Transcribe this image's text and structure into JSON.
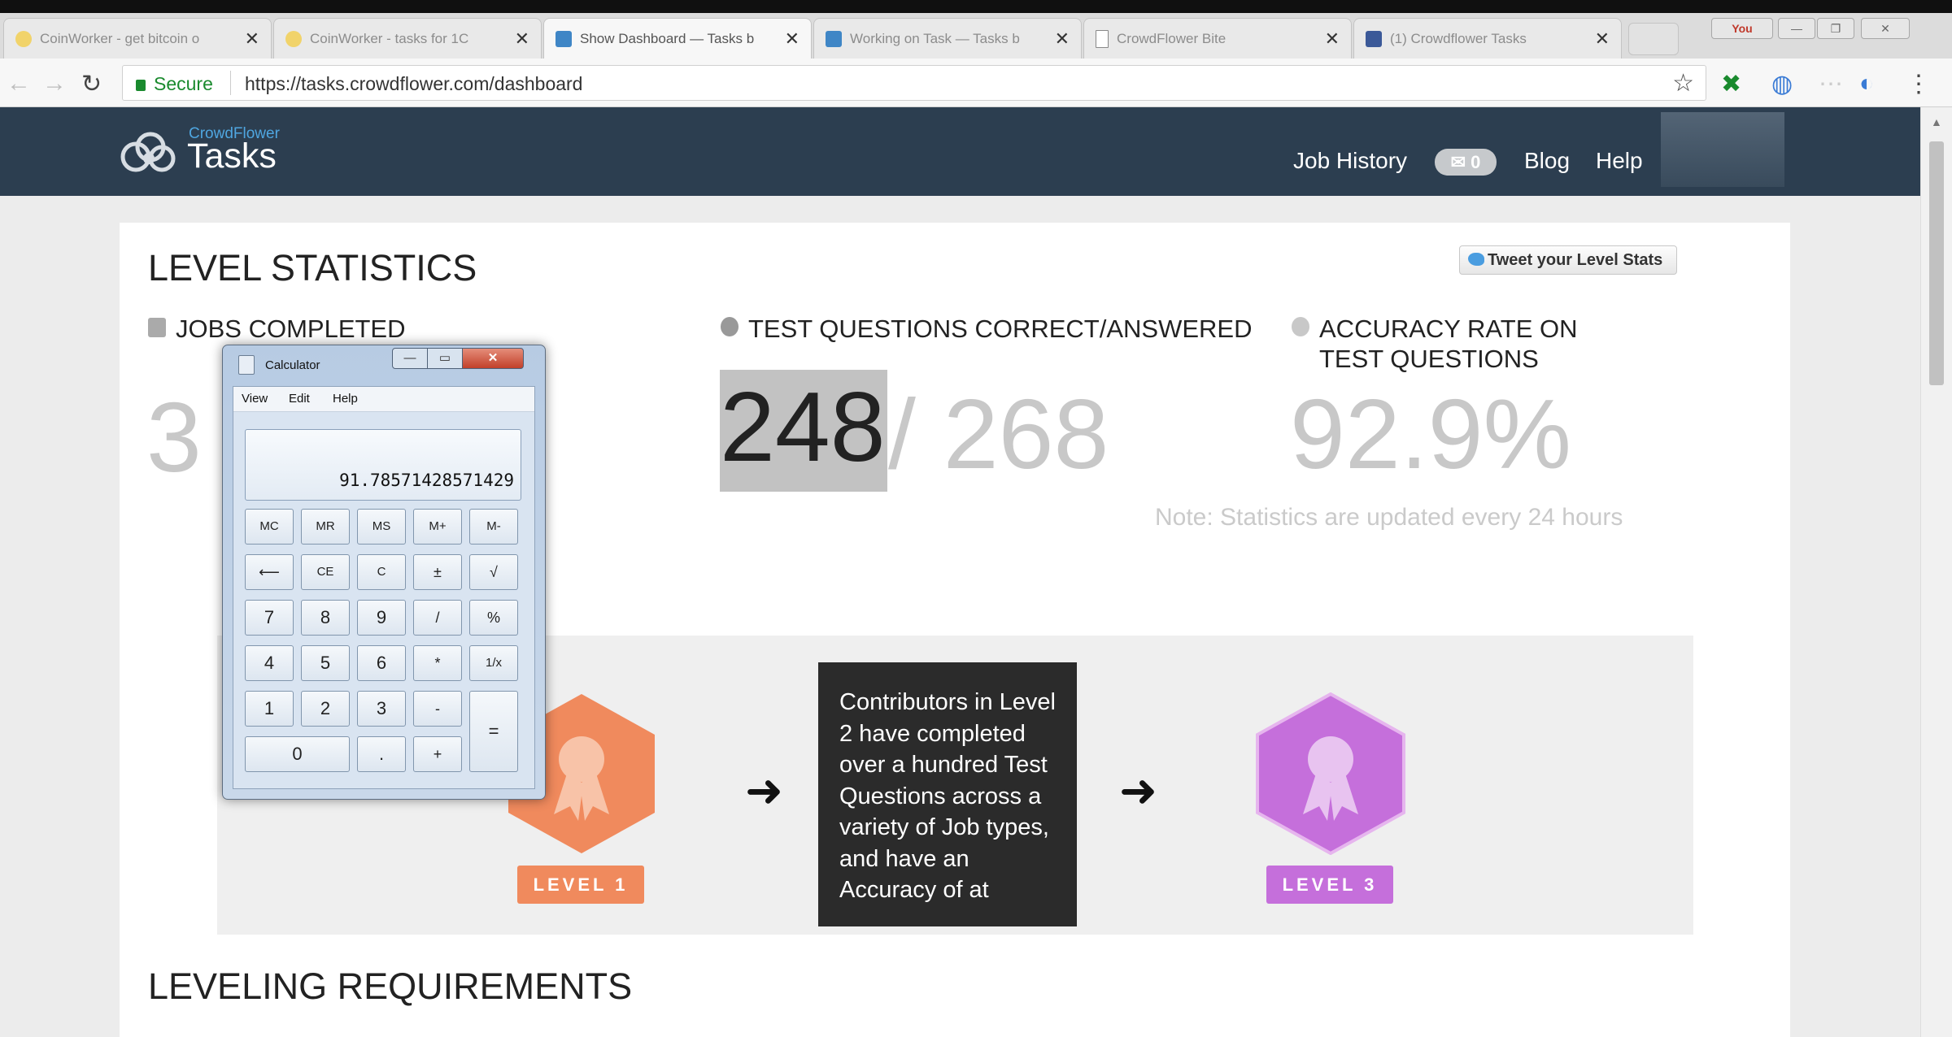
{
  "browser": {
    "tabs": [
      {
        "title": "CoinWorker - get bitcoin o",
        "active": false,
        "color": "#f1d36a"
      },
      {
        "title": "CoinWorker - tasks for 1C",
        "active": false,
        "color": "#f1d36a"
      },
      {
        "title": "Show Dashboard — Tasks b",
        "active": true,
        "color": "#3f86c6"
      },
      {
        "title": "Working on Task — Tasks b",
        "active": false,
        "color": "#3f86c6"
      },
      {
        "title": "CrowdFlower Bite",
        "active": false,
        "color": "#9aa5b0"
      },
      {
        "title": "(1) Crowdflower Tasks",
        "active": false,
        "color": "#3b5998"
      }
    ],
    "tab_close": "✕",
    "user_chip": "You",
    "window_controls": {
      "minimize": "—",
      "maximize": "❐",
      "close": "✕"
    },
    "nav": {
      "back": "←",
      "forward": "→",
      "reload": "↻"
    },
    "secure_label": "Secure",
    "url": "https://tasks.crowdflower.com/dashboard",
    "bookmark": "☆",
    "extensions": [
      "✖",
      "◍",
      "⋯",
      "◐",
      "⋮"
    ]
  },
  "site": {
    "brand_small": "CrowdFlower",
    "brand_big": "Tasks",
    "nav_links": {
      "job_history": "Job History",
      "messages_count": "✉ 0",
      "blog": "Blog",
      "help": "Help"
    }
  },
  "dashboard": {
    "title": "LEVEL STATISTICS",
    "tweet": "Tweet your Level Stats",
    "jobs_completed": {
      "label": "JOBS COMPLETED",
      "value": "3"
    },
    "test_questions": {
      "label": "TEST QUESTIONS CORRECT/ANSWERED",
      "correct": "248",
      "answered": "/ 268"
    },
    "accuracy": {
      "label_line1": "ACCURACY RATE ON",
      "label_line2": "TEST QUESTIONS",
      "value": "92.9%"
    },
    "note": "Note: Statistics are updated every 24 hours",
    "levels": {
      "level1": {
        "label": "LEVEL 1",
        "color": "#f08a5d"
      },
      "level3": {
        "label": "LEVEL 3",
        "color": "#c56fdb"
      },
      "arrow": "➜",
      "tooltip": "Contributors in Level 2 have completed over a hundred Test Questions across a variety of Job types, and have an Accuracy of at"
    },
    "leveling_title": "LEVELING REQUIREMENTS"
  },
  "calculator": {
    "title": "Calculator",
    "menu": [
      "View",
      "Edit",
      "Help"
    ],
    "display": "91.78571428571429",
    "keys": {
      "mc": "MC",
      "mr": "MR",
      "ms": "MS",
      "mplus": "M+",
      "mminus": "M-",
      "back": "⟵",
      "ce": "CE",
      "c": "C",
      "pm": "±",
      "sqrt": "√",
      "k7": "7",
      "k8": "8",
      "k9": "9",
      "div": "/",
      "pct": "%",
      "k4": "4",
      "k5": "5",
      "k6": "6",
      "mul": "*",
      "inv": "1/x",
      "k1": "1",
      "k2": "2",
      "k3": "3",
      "sub": "-",
      "eq": "=",
      "k0": "0",
      "dot": ".",
      "add": "+"
    }
  }
}
